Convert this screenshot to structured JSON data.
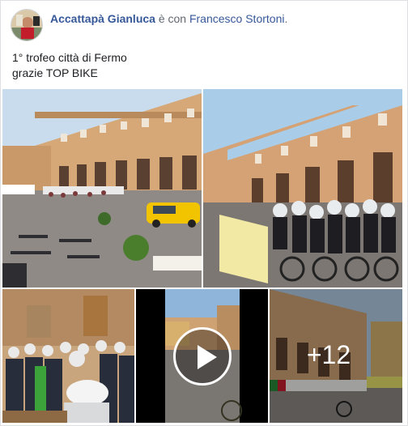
{
  "post": {
    "author": "Accattapà Gianluca",
    "with_text": "è con",
    "tagged": "Francesco Stortoni",
    "tagged_suffix": "."
  },
  "caption": {
    "line1": "1° trofeo città di Fermo",
    "line2": "grazie TOP BIKE"
  },
  "gallery": {
    "more_count": "+12"
  },
  "icons": {
    "video": "play-icon",
    "avatar": "user-avatar"
  },
  "colors": {
    "link": "#365899",
    "secondary": "#616770",
    "text": "#1c1e21",
    "border": "#dddfe2"
  }
}
